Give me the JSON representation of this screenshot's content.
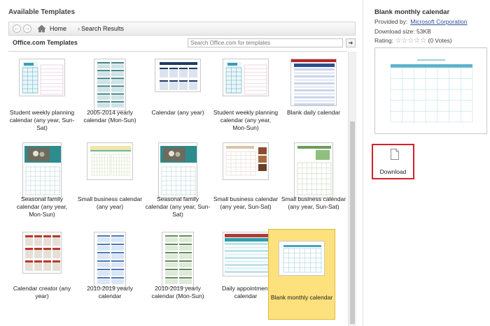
{
  "section_title": "Available Templates",
  "nav": {
    "back_symbol": "←",
    "forward_symbol": "→",
    "home_label": "Home",
    "separator": "›",
    "results_label": "Search Results"
  },
  "source": {
    "label": "Office.com Templates",
    "search_placeholder": "Search Office.com for templates",
    "search_go": "➔"
  },
  "templates": [
    {
      "label": "Student weekly planning calendar (any year, Sun-Sat)",
      "thumb": "planner-teal"
    },
    {
      "label": "2005-2014 yearly calendar (Mon-Sun)",
      "thumb": "yearly-multi"
    },
    {
      "label": "Calendar (any year)",
      "thumb": "calendar-navy"
    },
    {
      "label": "Student weekly planning calendar (any year, Mon-Sun)",
      "thumb": "planner-teal"
    },
    {
      "label": "Blank daily calendar",
      "thumb": "daily-blue"
    },
    {
      "label": "Seasonal family calendar (any year, Mon-Sun)",
      "thumb": "family-photo"
    },
    {
      "label": "Small business calendar (any year)",
      "thumb": "business-yellow"
    },
    {
      "label": "Seasonal family calendar (any year, Sun-Sat)",
      "thumb": "family-photo"
    },
    {
      "label": "Small business calendar (any year, Sun-Sat)",
      "thumb": "business-brown"
    },
    {
      "label": "Small business calendar (any year, Sun-Sat)",
      "thumb": "business-green"
    },
    {
      "label": "Calendar creator (any year)",
      "thumb": "creator-red"
    },
    {
      "label": "2010-2019 yearly calendar",
      "thumb": "yearly-blue"
    },
    {
      "label": "2010-2019 yearly calendar (Mon-Sun)",
      "thumb": "yearly-green"
    },
    {
      "label": "Daily appointment calendar",
      "thumb": "appointment-teal"
    },
    {
      "label": "Blank monthly calendar",
      "thumb": "monthly-teal",
      "selected": true
    }
  ],
  "detail": {
    "title": "Blank monthly calendar",
    "provided_by_label": "Provided by:",
    "provider": "Microsoft Corporation",
    "download_size": "Download size:  53KB",
    "rating_label": "Rating:",
    "stars": "☆☆☆☆☆",
    "votes": "(0 Votes)",
    "download_label": "Download"
  },
  "colors": {
    "selected_tile": "#fce17c",
    "download_highlight": "#d6202a",
    "link": "#2a4f9a",
    "calendar_accent": "#4aa3c0"
  }
}
